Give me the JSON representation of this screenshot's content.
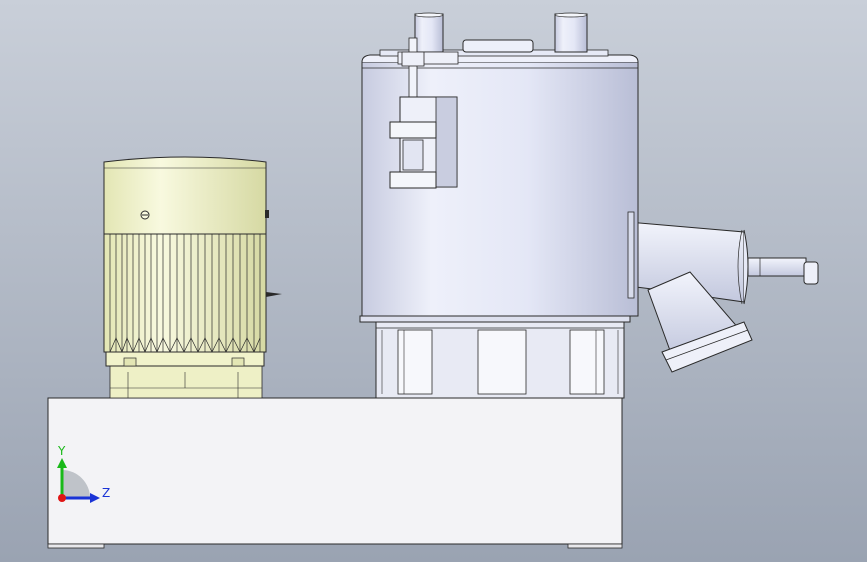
{
  "viewport": {
    "background_top": "#c9cfd9",
    "background_bottom": "#9aa3b2"
  },
  "colors": {
    "outline": "#2a2a2a",
    "metal_light": "#f4f6fb",
    "metal_mid": "#dfe3ef",
    "metal_dark": "#b9bed0",
    "motor_yellow": "#f3f5d0",
    "motor_yellow_dark": "#d9dca9",
    "base_fill": "#f3f3f6",
    "axis_y": "#19b919",
    "axis_z": "#1a33d6",
    "axis_x": "#e01515",
    "axis_arc": "#bfc3c9"
  },
  "triad": {
    "y_label": "Y",
    "z_label": "Z"
  }
}
